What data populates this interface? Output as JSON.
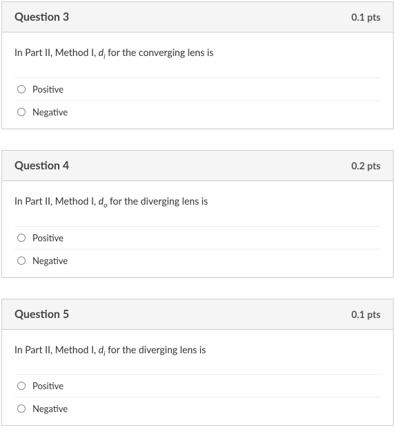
{
  "questions": [
    {
      "title": "Question 3",
      "pts": "0.1 pts",
      "prompt_prefix": "In Part II, Method I, ",
      "prompt_var": "d",
      "prompt_sub": "i",
      "prompt_suffix": " for the converging lens is",
      "options": [
        {
          "label": "Positive"
        },
        {
          "label": "Negative"
        }
      ]
    },
    {
      "title": "Question 4",
      "pts": "0.2 pts",
      "prompt_prefix": "In Part II, Method I, ",
      "prompt_var": "d",
      "prompt_sub": "o",
      "prompt_suffix": " for the diverging lens is",
      "options": [
        {
          "label": "Positive"
        },
        {
          "label": "Negative"
        }
      ]
    },
    {
      "title": "Question 5",
      "pts": "0.1 pts",
      "prompt_prefix": "In Part II, Method I, ",
      "prompt_var": "d",
      "prompt_sub": "i",
      "prompt_suffix": " for the diverging lens is",
      "options": [
        {
          "label": "Positive"
        },
        {
          "label": "Negative"
        }
      ]
    }
  ]
}
